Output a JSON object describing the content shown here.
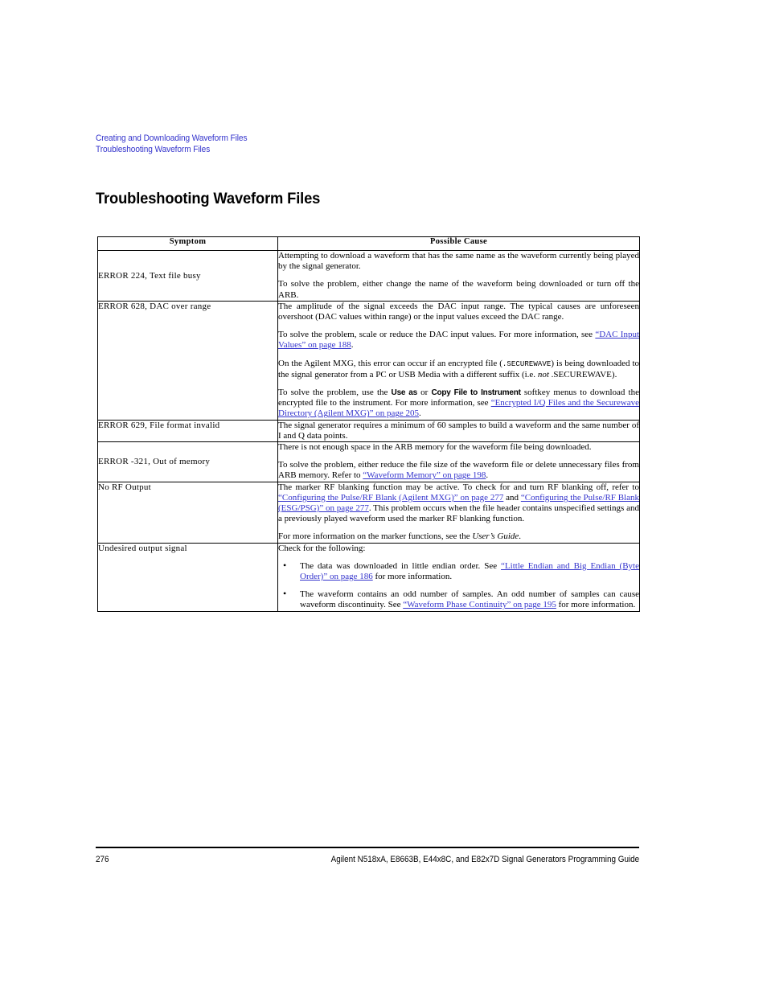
{
  "header": {
    "breadcrumb_line1": "Creating and Downloading Waveform Files",
    "breadcrumb_line2": "Troubleshooting Waveform Files",
    "link_color": "#3333cc"
  },
  "title": "Troubleshooting Waveform Files",
  "table": {
    "columns": [
      "Symptom",
      "Possible Cause"
    ],
    "rows": [
      {
        "symptom": "ERROR 224, Text file busy",
        "symptom_align": "middle",
        "paragraphs": [
          [
            {
              "t": "text",
              "v": "Attempting to download a waveform that has the same name as the waveform currently being played by the signal generator."
            }
          ],
          [
            {
              "t": "text",
              "v": "To solve the problem, either change the name of the waveform being downloaded or turn off the ARB."
            }
          ]
        ]
      },
      {
        "symptom": "ERROR 628, DAC over range",
        "symptom_align": "top",
        "paragraphs": [
          [
            {
              "t": "text",
              "v": "The amplitude of the signal exceeds the DAC input range. The typical causes are unforeseen overshoot (DAC values within range) or the input values exceed the DAC range."
            }
          ],
          [
            {
              "t": "text",
              "v": "To solve the problem, scale or reduce the DAC input values. For more information, see "
            },
            {
              "t": "link",
              "v": "“DAC Input Values” on page 188"
            },
            {
              "t": "text",
              "v": "."
            }
          ],
          [
            {
              "t": "text",
              "v": "On the Agilent MXG, this error can occur if an encrypted file ("
            },
            {
              "t": "mono",
              "v": ".SECUREWAVE"
            },
            {
              "t": "text",
              "v": ") is being downloaded to the signal generator from a PC or USB Media with a different suffix (i.e. "
            },
            {
              "t": "italic",
              "v": "not"
            },
            {
              "t": "text",
              "v": " .SECUREWAVE)."
            }
          ],
          [
            {
              "t": "text",
              "v": "To solve the problem, use the "
            },
            {
              "t": "softkey",
              "v": "Use as"
            },
            {
              "t": "text",
              "v": " or "
            },
            {
              "t": "softkey",
              "v": "Copy File to Instrument"
            },
            {
              "t": "text",
              "v": " softkey menus to download the encrypted file to the instrument. For more information, see "
            },
            {
              "t": "link",
              "v": "“Encrypted I/Q Files and the Securewave Directory (Agilent MXG)” on page 205"
            },
            {
              "t": "text",
              "v": "."
            }
          ]
        ]
      },
      {
        "symptom": "ERROR 629, File format invalid",
        "symptom_align": "top",
        "paragraphs": [
          [
            {
              "t": "text",
              "v": "The signal generator requires a minimum of 60 samples to build a waveform and the same number of I and Q data points."
            }
          ]
        ]
      },
      {
        "symptom": "ERROR -321, Out of memory",
        "symptom_align": "middle",
        "paragraphs": [
          [
            {
              "t": "text",
              "v": "There is not enough space in the ARB memory for the waveform file being downloaded."
            }
          ],
          [
            {
              "t": "text",
              "v": "To solve the problem, either reduce the file size of the waveform file or delete unnecessary files from ARB memory. Refer to "
            },
            {
              "t": "link",
              "v": "“Waveform Memory” on page 198"
            },
            {
              "t": "text",
              "v": "."
            }
          ]
        ]
      },
      {
        "symptom": "No RF Output",
        "symptom_align": "top",
        "paragraphs": [
          [
            {
              "t": "text",
              "v": "The marker RF blanking function may be active. To check for and turn RF blanking off, refer to "
            },
            {
              "t": "link",
              "v": "“Configuring the Pulse/RF Blank (Agilent MXG)” on page 277"
            },
            {
              "t": "text",
              "v": " and "
            },
            {
              "t": "link",
              "v": "“Configuring the Pulse/RF Blank (ESG/PSG)” on page 277"
            },
            {
              "t": "text",
              "v": ". This problem occurs when the file header contains unspecified settings and a previously played waveform used the marker RF blanking function."
            }
          ],
          [
            {
              "t": "text",
              "v": "For more information on the marker functions, see the "
            },
            {
              "t": "italic",
              "v": "User’s Guide"
            },
            {
              "t": "text",
              "v": "."
            }
          ]
        ]
      },
      {
        "symptom": "Undesired output signal",
        "symptom_align": "top",
        "paragraphs": [
          [
            {
              "t": "text",
              "v": "Check for the following:"
            }
          ]
        ],
        "bullets": [
          [
            {
              "t": "text",
              "v": "The data was downloaded in little endian order. See "
            },
            {
              "t": "link",
              "v": "“Little Endian and Big Endian (Byte Order)” on page 186"
            },
            {
              "t": "text",
              "v": " for more information."
            }
          ],
          [
            {
              "t": "text",
              "v": "The waveform contains an odd number of samples. An odd number of samples can cause waveform discontinuity. See "
            },
            {
              "t": "link",
              "v": "“Waveform Phase Continuity” on page 195"
            },
            {
              "t": "text",
              "v": " for more information."
            }
          ]
        ],
        "bullet_glyph": "•"
      }
    ]
  },
  "footer": {
    "page_number": "276",
    "document_title": "Agilent N518xA, E8663B, E44x8C, and E82x7D Signal Generators Programming Guide"
  }
}
